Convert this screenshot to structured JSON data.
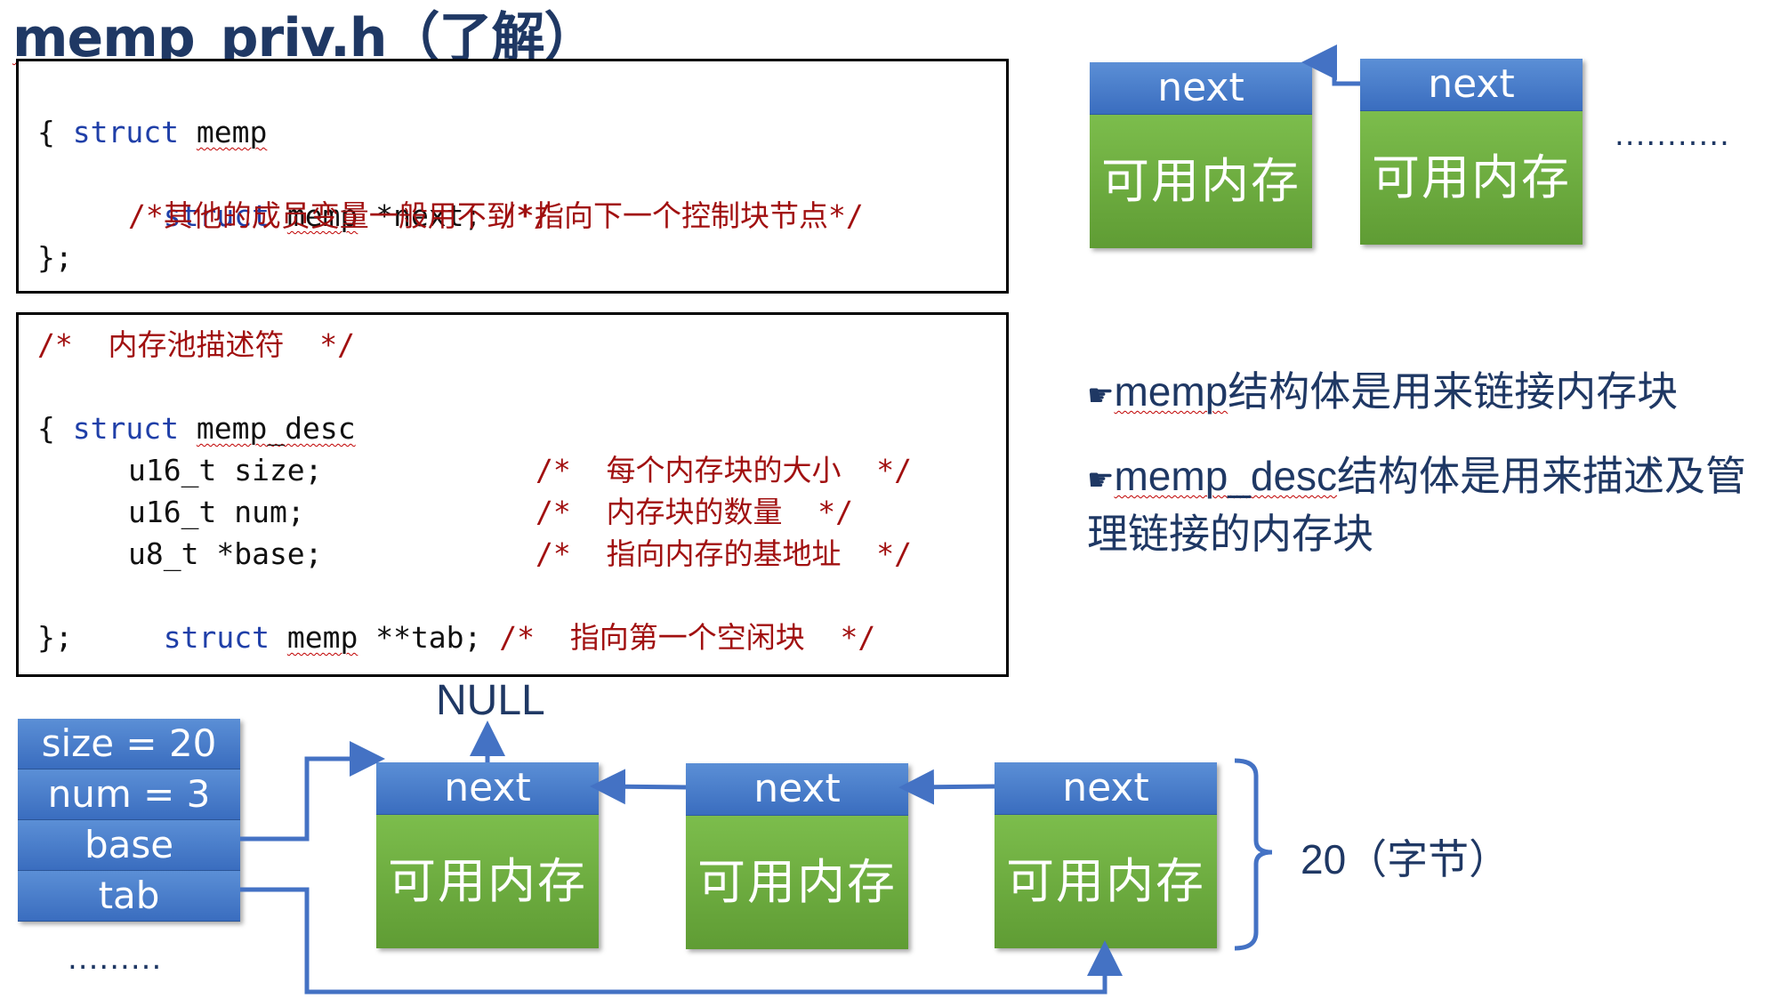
{
  "title": "memp_priv.h（了解）",
  "code1": {
    "line1_kw": "struct",
    "line1_id": "memp",
    "line2": "{",
    "line3_kw": "struct",
    "line3_id": "memp",
    "line3_rest": "*next;",
    "line3_cm": "/*指向下一个控制块节点*/",
    "line4_cm": "/*其他的成员变量一般用不到*/",
    "line5": "};"
  },
  "code2": {
    "line1_cm": "/*  内存池描述符  */",
    "line2_kw": "struct",
    "line2_id": "memp_desc",
    "line3": "{",
    "line4_code": "u16_t size;",
    "line4_cm": "/*  每个内存块的大小  */",
    "line5_code": "u16_t num;",
    "line5_cm": "/*  内存块的数量  */",
    "line6_code": "u8_t *base;",
    "line6_cm": "/*  指向内存的基地址  */",
    "line7_kw": "struct",
    "line7_id": "memp",
    "line7_rest": "**tab;",
    "line7_cm": "/*  指向第一个空闲块  */",
    "line8": "};"
  },
  "top_blocks": {
    "next_label": "next",
    "body_label": "可用内存",
    "ellipsis": "..........."
  },
  "bullets": {
    "marker": "☛",
    "b1_word": "memp",
    "b1_rest": "结构体是用来链接内存块",
    "b2_word": "memp_desc",
    "b2_rest1": "结构体是用来描述及管",
    "b2_rest2": "理链接的内存块"
  },
  "desc_struct": {
    "size": "size = 20",
    "num": "num = 3",
    "base": "base",
    "tab": "tab",
    "ellipsis": "........."
  },
  "bottom_blocks": {
    "null_label": "NULL",
    "next_label": "next",
    "body_label": "可用内存",
    "brace_label": "20（字节）"
  },
  "colors": {
    "title": "#1f3864",
    "keyword": "#1f3fa8",
    "comment": "#a11010",
    "block_header": "#4a7fc9",
    "block_body": "#6dab40",
    "arrow": "#4472c4"
  }
}
